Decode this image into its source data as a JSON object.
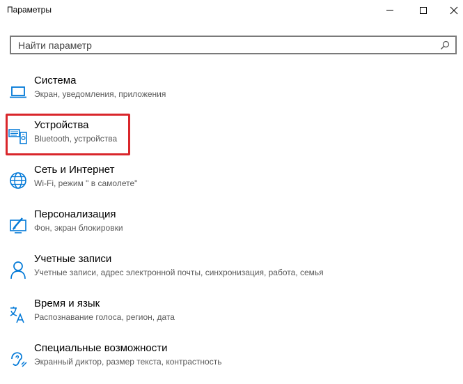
{
  "window": {
    "title": "Параметры"
  },
  "search": {
    "placeholder": "Найти параметр"
  },
  "items": [
    {
      "title": "Система",
      "subtitle": "Экран, уведомления, приложения",
      "icon": "laptop-icon"
    },
    {
      "title": "Устройства",
      "subtitle": "Bluetooth, устройства",
      "icon": "devices-icon"
    },
    {
      "title": "Сеть и Интернет",
      "subtitle": "Wi-Fi, режим \" в самолете\"",
      "icon": "globe-icon"
    },
    {
      "title": "Персонализация",
      "subtitle": "Фон, экран блокировки",
      "icon": "personalization-icon"
    },
    {
      "title": "Учетные записи",
      "subtitle": "Учетные записи, адрес электронной почты, синхронизация, работа, семья",
      "icon": "person-icon"
    },
    {
      "title": "Время и язык",
      "subtitle": "Распознавание голоса, регион, дата",
      "icon": "time-language-icon"
    },
    {
      "title": "Специальные возможности",
      "subtitle": "Экранный диктор, размер текста, контрастность",
      "icon": "accessibility-icon"
    }
  ],
  "colors": {
    "accent": "#0078d7",
    "highlight_border": "#d9262b"
  }
}
